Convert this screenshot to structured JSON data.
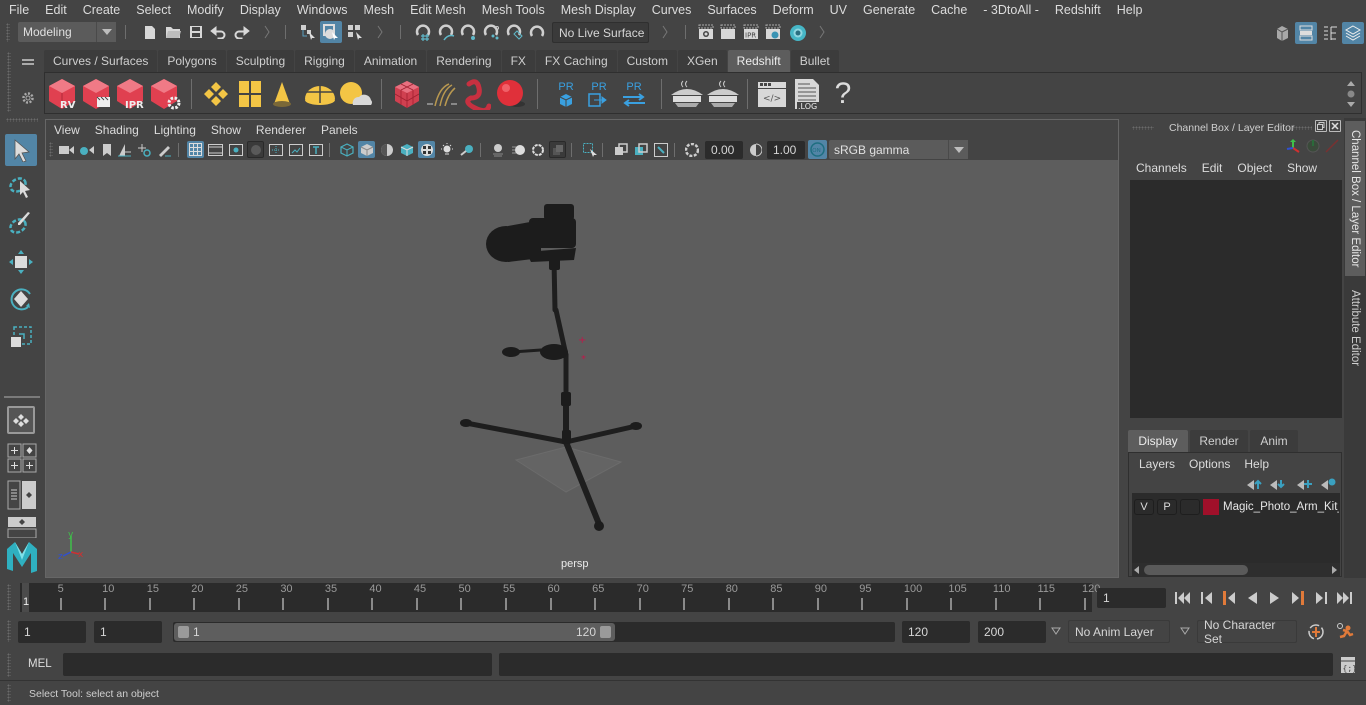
{
  "menubar": {
    "items": [
      "File",
      "Edit",
      "Create",
      "Select",
      "Modify",
      "Display",
      "Windows",
      "Mesh",
      "Edit Mesh",
      "Mesh Tools",
      "Mesh Display",
      "Curves",
      "Surfaces",
      "Deform",
      "UV",
      "Generate",
      "Cache",
      "- 3DtoAll -",
      "Redshift",
      "Help"
    ]
  },
  "statusline": {
    "menuset": "Modeling",
    "live_surface": "No Live Surface",
    "icons": [
      "new-scene-icon",
      "open-scene-icon",
      "save-scene-icon",
      "undo-icon",
      "redo-icon",
      "select-hierarchy-icon",
      "select-object-icon",
      "select-component-icon",
      "snap-grid-icon",
      "snap-curve-icon",
      "snap-point-icon",
      "snap-view-plane-icon",
      "snap-surface-icon",
      "snap-live-icon",
      "render-view-icon",
      "render-current-icon",
      "ipr-render-icon",
      "render-settings-icon",
      "hypershade-icon"
    ]
  },
  "shelf": {
    "tabs": [
      "Curves / Surfaces",
      "Polygons",
      "Sculpting",
      "Rigging",
      "Animation",
      "Rendering",
      "FX",
      "FX Caching",
      "Custom",
      "XGen",
      "Redshift",
      "Bullet"
    ],
    "active_tab": "Redshift",
    "icons": [
      {
        "name": "redshift-render-view-icon",
        "label": "RV"
      },
      {
        "name": "redshift-batch-render-icon",
        "label": ""
      },
      {
        "name": "redshift-ipr-icon",
        "label": "IPR"
      },
      {
        "name": "redshift-render-settings-icon",
        "label": ""
      },
      {
        "name": "redshift-area-light-icon",
        "label": ""
      },
      {
        "name": "redshift-portal-light-icon",
        "label": ""
      },
      {
        "name": "redshift-ies-light-icon",
        "label": ""
      },
      {
        "name": "redshift-dome-light-icon",
        "label": ""
      },
      {
        "name": "redshift-sun-sky-icon",
        "label": ""
      },
      {
        "name": "redshift-proxy-icon",
        "label": ""
      },
      {
        "name": "redshift-volume-icon",
        "label": ""
      },
      {
        "name": "redshift-curve-icon",
        "label": ""
      },
      {
        "name": "redshift-material-icon",
        "label": ""
      },
      {
        "name": "redshift-pr-mesh-icon",
        "label": "PR"
      },
      {
        "name": "redshift-pr-export-icon",
        "label": "PR"
      },
      {
        "name": "redshift-pr-convert-icon",
        "label": "PR"
      },
      {
        "name": "redshift-bake-icon",
        "label": ""
      },
      {
        "name": "redshift-bake-options-icon",
        "label": ""
      },
      {
        "name": "redshift-script-editor-icon",
        "label": ""
      },
      {
        "name": "redshift-log-icon",
        "label": ".LOG"
      },
      {
        "name": "redshift-help-icon",
        "label": "?"
      }
    ]
  },
  "viewport": {
    "menus": [
      "View",
      "Shading",
      "Lighting",
      "Show",
      "Renderer",
      "Panels"
    ],
    "exposure": "0.00",
    "gamma": "1.00",
    "color_management_toggle": "ON",
    "color_space": "sRGB gamma",
    "camera_label": "persp",
    "axis": {
      "x": "x",
      "y": "y",
      "z": "z"
    }
  },
  "channel_box": {
    "title": "Channel Box / Layer Editor",
    "menus": [
      "Channels",
      "Edit",
      "Object",
      "Show"
    ]
  },
  "layer_editor": {
    "tabs": [
      "Display",
      "Render",
      "Anim"
    ],
    "active_tab": "Display",
    "menus": [
      "Layers",
      "Options",
      "Help"
    ],
    "layers": [
      {
        "visible": "V",
        "playback": "P",
        "type": "",
        "color": "#a0102a",
        "name": "Magic_Photo_Arm_Kit_"
      }
    ]
  },
  "side_tabs": [
    "Channel Box / Layer Editor",
    "Attribute Editor"
  ],
  "timeline": {
    "start_frame_label": "1",
    "ticks": [
      5,
      10,
      15,
      20,
      25,
      30,
      35,
      40,
      45,
      50,
      55,
      60,
      65,
      70,
      75,
      80,
      85,
      90,
      95,
      100,
      105,
      110,
      115,
      120
    ],
    "min": 1,
    "max": 120,
    "current_frame": "1"
  },
  "range": {
    "start": "1",
    "playback_start": "1",
    "slider_start": "1",
    "slider_end": "120",
    "playback_end": "120",
    "end": "200",
    "anim_layer": "No Anim Layer",
    "character_set": "No Character Set"
  },
  "command_line": {
    "language": "MEL",
    "input": "",
    "output": ""
  },
  "help_line": {
    "text": "Select Tool: select an object"
  }
}
